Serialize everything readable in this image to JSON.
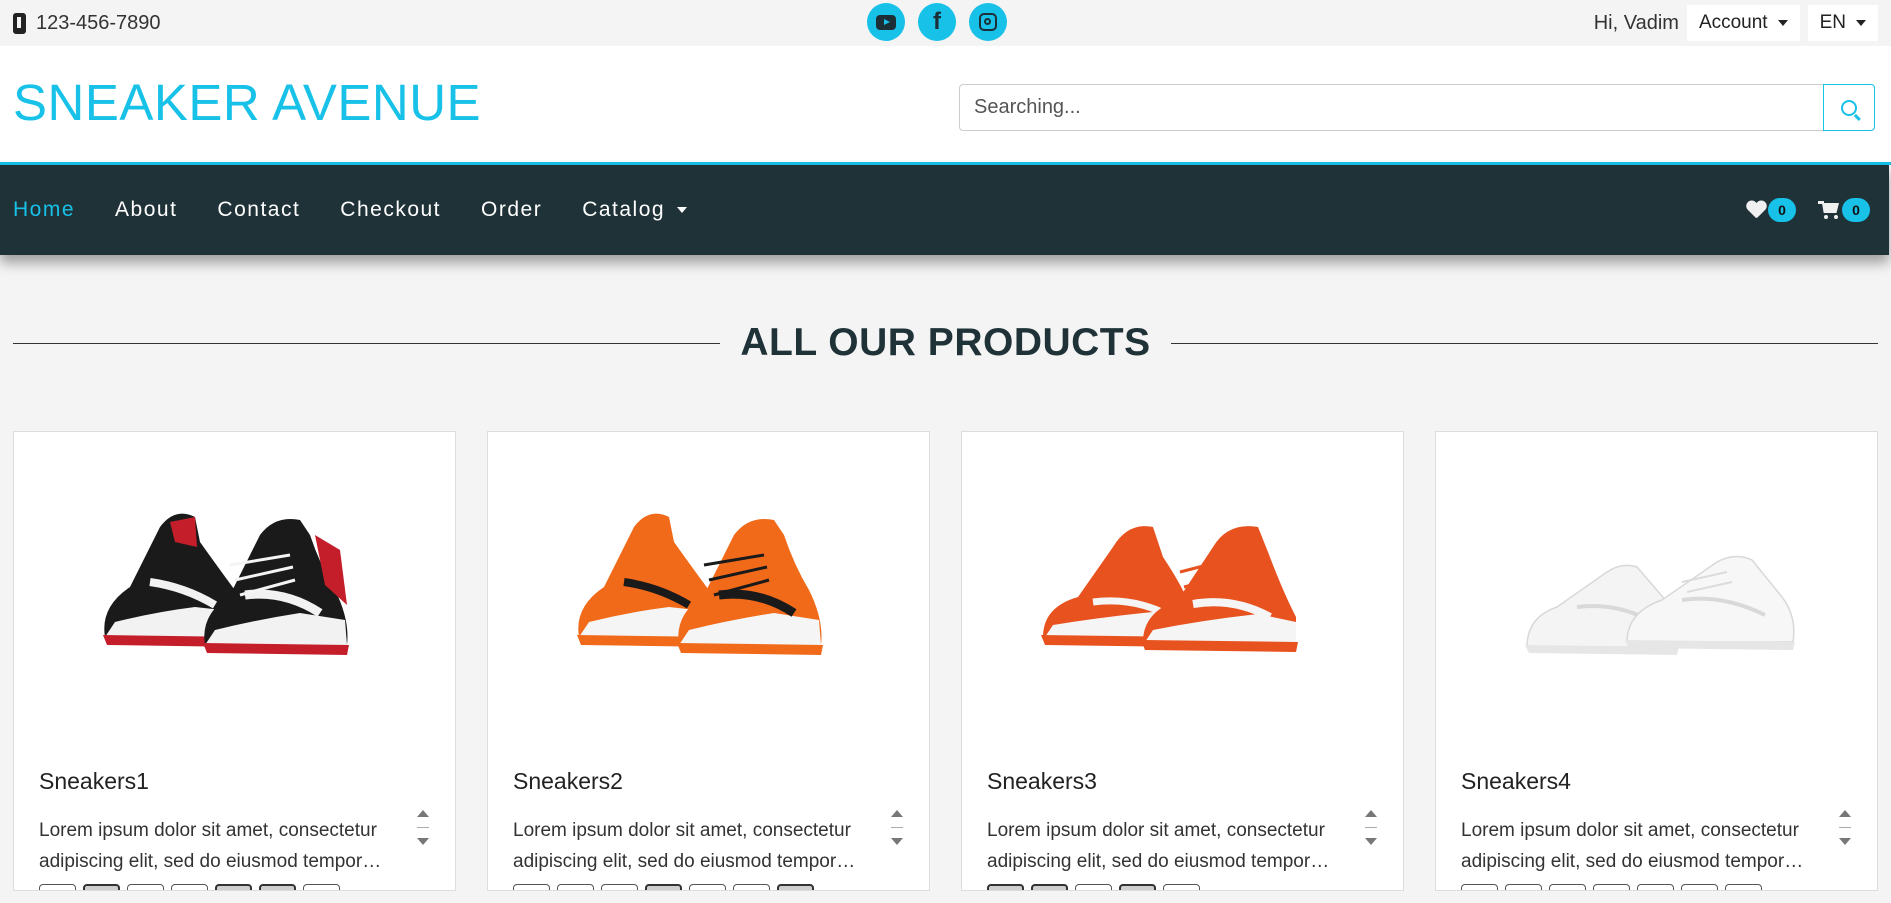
{
  "topbar": {
    "phone": "123-456-7890",
    "greeting": "Hi, Vadim",
    "account_label": "Account",
    "language": "EN",
    "socials": [
      "youtube-icon",
      "facebook-icon",
      "instagram-icon"
    ]
  },
  "header": {
    "logo": "SNEAKER AVENUE",
    "search_placeholder": "Searching..."
  },
  "nav": {
    "items": [
      {
        "label": "Home",
        "active": true
      },
      {
        "label": "About"
      },
      {
        "label": "Contact"
      },
      {
        "label": "Checkout"
      },
      {
        "label": "Order"
      },
      {
        "label": "Catalog"
      }
    ],
    "wishlist_count": "0",
    "cart_count": "0"
  },
  "section": {
    "title": "ALL OUR PRODUCTS"
  },
  "products": [
    {
      "name": "Sneakers1",
      "description": "Lorem ipsum dolor sit amet, consectetur adipiscing elit, sed do eiusmod tempor incididunt ut labore et dolore magna aliqua.",
      "colors": [
        "#1a1a1a",
        "#e8e8e8",
        "#c41e2a"
      ]
    },
    {
      "name": "Sneakers2",
      "description": "Lorem ipsum dolor sit amet, consectetur adipiscing elit, sed do eiusmod tempor incididunt ut labore et dolore magna aliqua.",
      "colors": [
        "#1a1a1a",
        "#f5f5f5",
        "#f06a1a"
      ]
    },
    {
      "name": "Sneakers3",
      "description": "Lorem ipsum dolor sit amet, consectetur adipiscing elit, sed do eiusmod tempor incididunt ut labore et dolore magna aliqua.",
      "colors": [
        "#e8521f",
        "#f5f5f5",
        "#ffffff"
      ]
    },
    {
      "name": "Sneakers4",
      "description": "Lorem ipsum dolor sit amet, consectetur adipiscing elit, sed do eiusmod tempor incididunt ut labore et dolore magna aliqua.",
      "colors": [
        "#f4f4f4",
        "#e6e6e6",
        "#d9d9d9"
      ]
    }
  ],
  "colors": {
    "accent": "#17c1e8",
    "nav_bg": "#1f3238",
    "page_bg": "#f4f4f4"
  }
}
